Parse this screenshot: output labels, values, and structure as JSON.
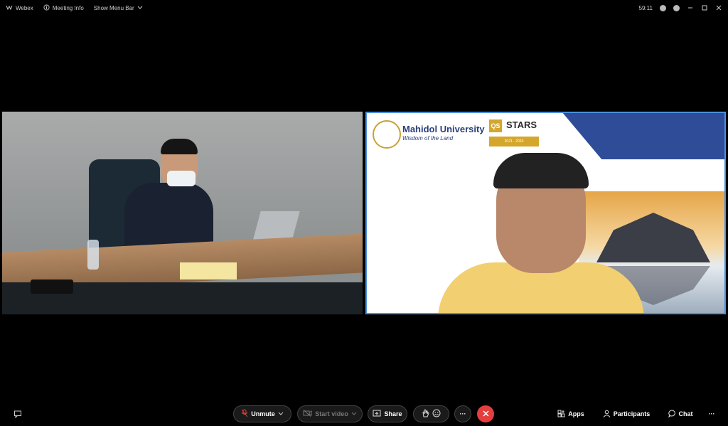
{
  "topbar": {
    "app_name": "Webex",
    "meeting_info": "Meeting Info",
    "show_menu": "Show Menu Bar",
    "timer": "59:11"
  },
  "video_right": {
    "university": "Mahidol University",
    "motto": "Wisdom of the Land",
    "qs_box": "QS",
    "stars": "STARS",
    "rating_years": "2021 · 2024"
  },
  "controls": {
    "unmute": "Unmute",
    "start_video": "Start video",
    "share": "Share",
    "more": "···",
    "apps": "Apps",
    "participants": "Participants",
    "chat": "Chat",
    "overflow": "···"
  },
  "colors": {
    "accent": "#4a90e2",
    "end_call": "#e53e3e"
  }
}
